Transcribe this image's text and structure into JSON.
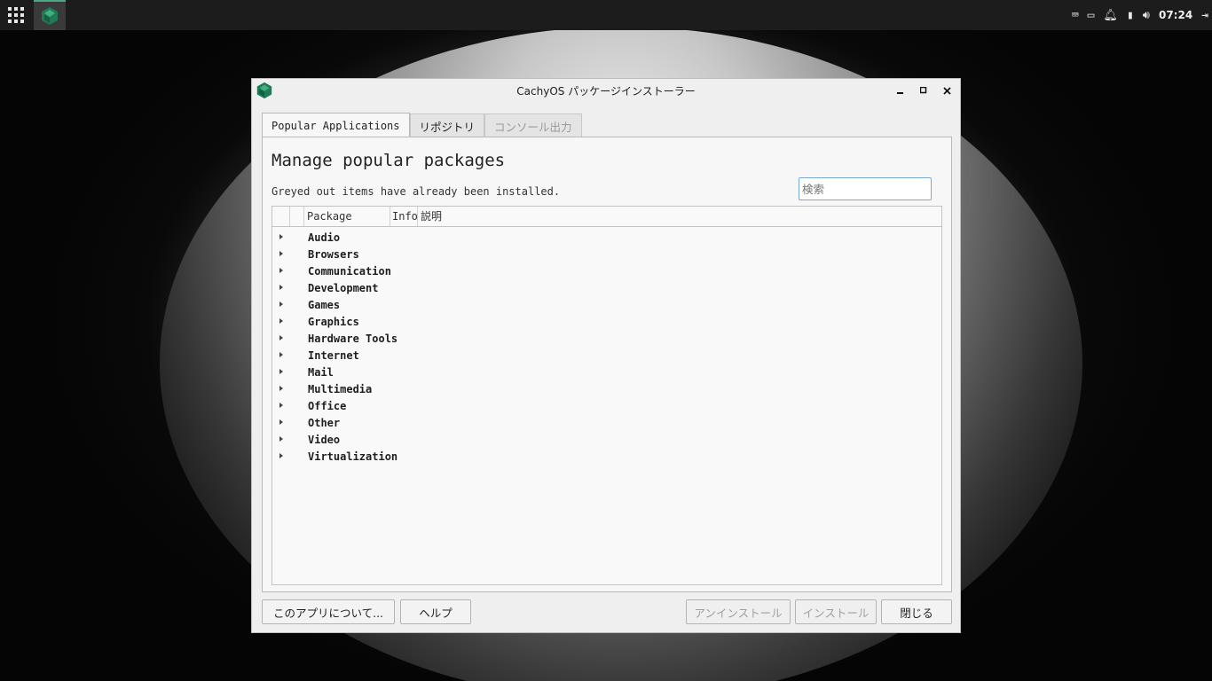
{
  "taskbar": {
    "clock": "07:24",
    "tray_icons": [
      "keyboard-icon",
      "screen-icon",
      "bell-icon",
      "battery-icon",
      "volume-icon",
      "logout-icon"
    ]
  },
  "window": {
    "title": "CachyOS パッケージインストーラー",
    "tabs": [
      {
        "label": "Popular Applications",
        "state": "active"
      },
      {
        "label": "リポジトリ",
        "state": "normal"
      },
      {
        "label": "コンソール出力",
        "state": "disabled"
      }
    ],
    "heading": "Manage popular packages",
    "subtitle": "Greyed out items have already been installed.",
    "search_placeholder": "検索",
    "columns": {
      "package": "Package",
      "info": "Info",
      "description": "説明"
    },
    "categories": [
      "Audio",
      "Browsers",
      "Communication",
      "Development",
      "Games",
      "Graphics",
      "Hardware Tools",
      "Internet",
      "Mail",
      "Multimedia",
      "Office",
      "Other",
      "Video",
      "Virtualization"
    ],
    "buttons": {
      "about": "このアプリについて...",
      "help": "ヘルプ",
      "uninstall": "アンインストール",
      "install": "インストール",
      "close": "閉じる"
    }
  },
  "colors": {
    "accent": "#1f7a55",
    "focus_border": "#7aa7d6",
    "taskbar": "#1c1c1c"
  }
}
